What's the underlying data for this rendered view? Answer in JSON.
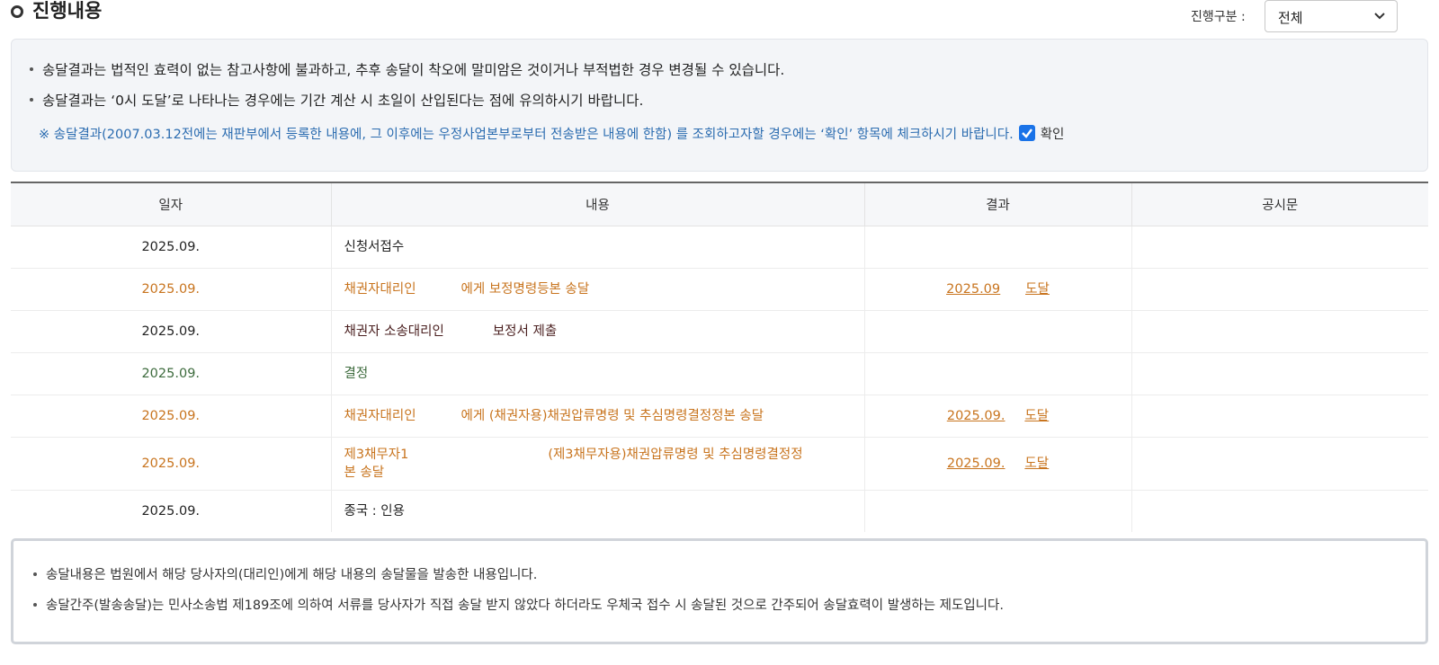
{
  "header": {
    "title": "진행내용",
    "filter_label": "진행구분 :",
    "filter_value": "전체"
  },
  "notice": {
    "lines": [
      "송달결과는 법적인 효력이 없는 참고사항에 불과하고, 추후 송달이 착오에 말미암은 것이거나 부적법한 경우 변경될 수 있습니다.",
      "송달결과는 ‘0시 도달’로 나타나는 경우에는 기간 계산 시 초일이 산입된다는 점에 유의하시기 바랍니다."
    ],
    "note": "※ 송달결과(2007.03.12전에는 재판부에서 등록한 내용에, 그 이후에는 우정사업본부로부터 전송받은 내용에 한함) 를 조회하고자할 경우에는 ‘확인’ 항목에 체크하시기 바랍니다.",
    "checkbox_label": "확인",
    "checkbox_checked": true
  },
  "table": {
    "headers": [
      "일자",
      "내용",
      "결과",
      "공시문"
    ],
    "rows": [
      {
        "date": "2025.09.",
        "content_a": "신청서접수",
        "content_b": "",
        "result_a": "",
        "result_b": "",
        "color": "black"
      },
      {
        "date": "2025.09.",
        "content_a": "채권자대리인",
        "content_b": "에게 보정명령등본 송달",
        "result_a": "2025.09",
        "result_b": "도달",
        "color": "orange"
      },
      {
        "date": "2025.09.",
        "content_a": "채권자 소송대리인",
        "content_b": "보정서 제출",
        "result_a": "",
        "result_b": "",
        "color": "dark"
      },
      {
        "date": "2025.09.",
        "content_a": "결정",
        "content_b": "",
        "result_a": "",
        "result_b": "",
        "color": "green"
      },
      {
        "date": "2025.09.",
        "content_a": "채권자대리인",
        "content_b": "에게 (채권자용)채권압류명령 및 추심명령결정정본 송달",
        "result_a": "2025.09.",
        "result_b": "도달",
        "color": "orange"
      },
      {
        "date": "2025.09.",
        "content_a": "제3채무자1",
        "content_b": "(제3채무자용)채권압류명령 및 추심명령결정정",
        "content_c": "본 송달",
        "result_a": "2025.09.",
        "result_b": "도달",
        "color": "orange"
      },
      {
        "date": "2025.09.",
        "content_a": "종국 : 인용",
        "content_b": "",
        "result_a": "",
        "result_b": "",
        "color": "black"
      }
    ]
  },
  "info": {
    "lines": [
      "송달내용은 법원에서 해당 당사자의(대리인)에게 해당 내용의 송달물을 발송한 내용입니다.",
      "송달간주(발송송달)는 민사소송법 제189조에 의하여 서류를 당사자가 직접 송달 받지 않았다 하더라도 우체국 접수 시 송달된 것으로 간주되어 송달효력이 발생하는 제도입니다."
    ]
  }
}
